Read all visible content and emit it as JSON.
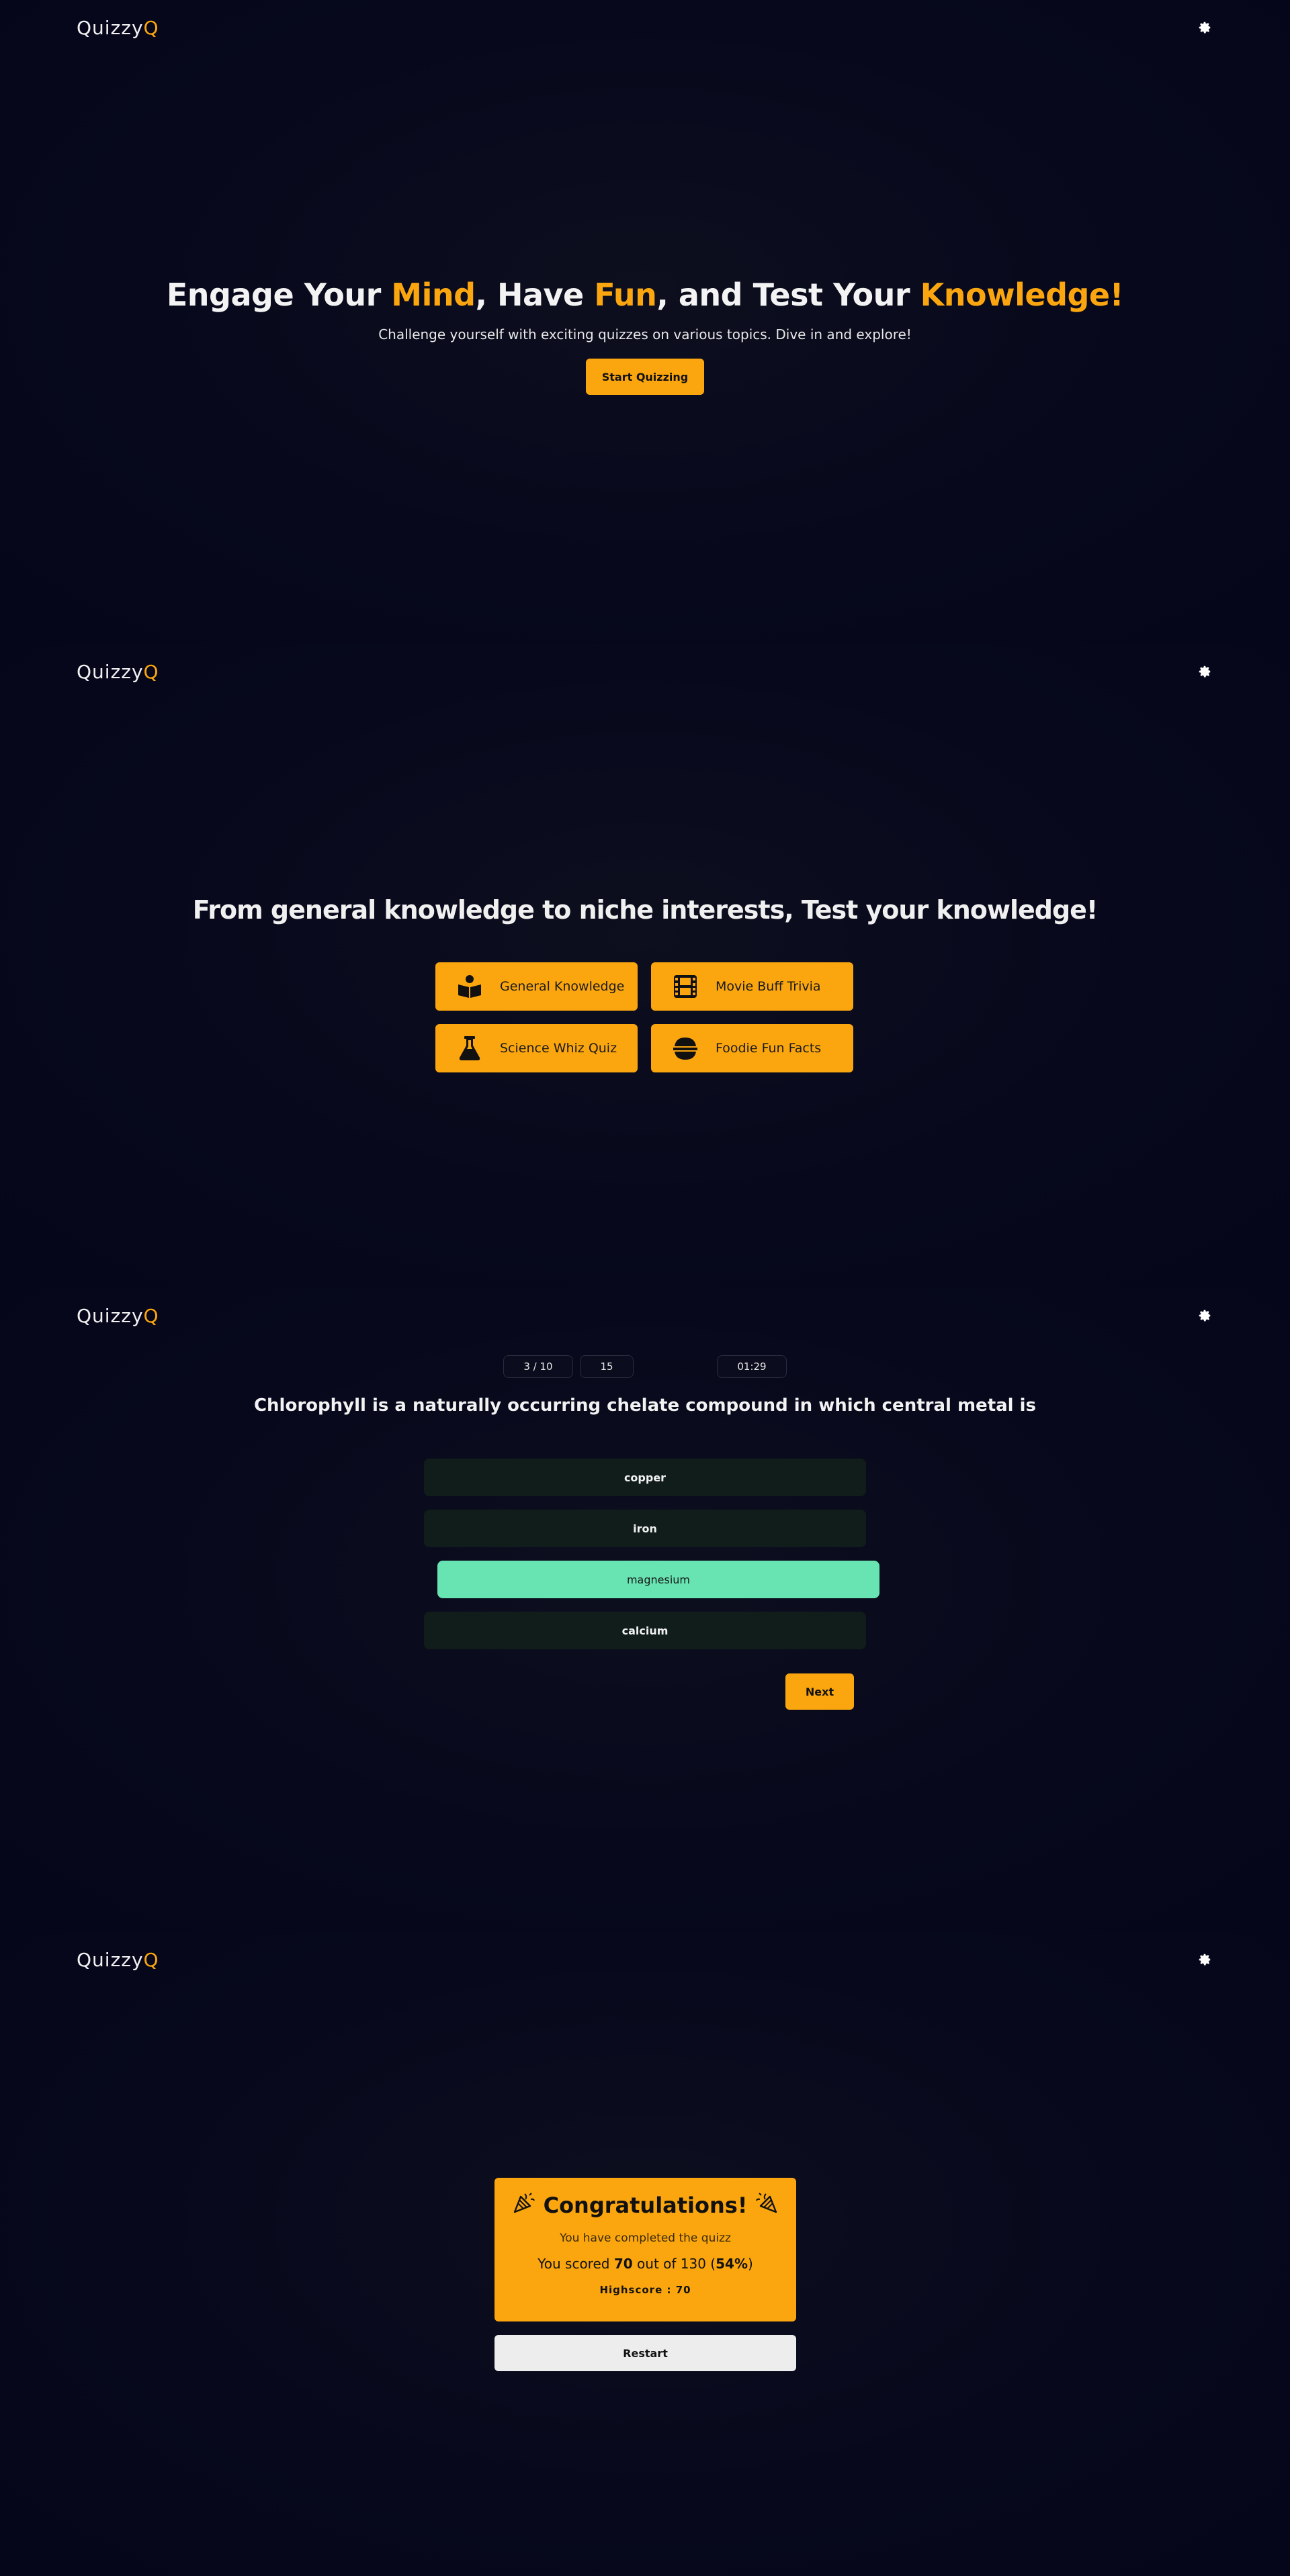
{
  "brand": {
    "name": "Quizzy",
    "accent_letter": "Q",
    "accent_color": "#fba60f"
  },
  "settings_icon": "gear-icon",
  "hero": {
    "title_parts": [
      "Engage Your ",
      "Mind",
      ", Have ",
      "Fun",
      ", and Test Your ",
      "Knowledge!"
    ],
    "subtitle": "Challenge yourself with exciting quizzes on various topics. Dive in and explore!",
    "start_label": "Start Quizzing"
  },
  "categories": {
    "title": "From general knowledge to niche interests, Test your knowledge!",
    "items": [
      {
        "label": "General Knowledge",
        "icon": "book-reader-icon"
      },
      {
        "label": "Movie Buff Trivia",
        "icon": "film-icon"
      },
      {
        "label": "Science Whiz Quiz",
        "icon": "flask-icon"
      },
      {
        "label": "Foodie Fun Facts",
        "icon": "food-bowl-icon"
      }
    ]
  },
  "quiz": {
    "progress": "3 / 10",
    "score": "15",
    "timer": "01:29",
    "question": "Chlorophyll is a naturally occurring chelate compound in which central metal is",
    "options": [
      "copper",
      "iron",
      "magnesium",
      "calcium"
    ],
    "selected_index": 2,
    "next_label": "Next"
  },
  "result": {
    "title": "Congratulations!",
    "completed": "You have completed the quizz",
    "scored_prefix": "You scored ",
    "score": "70",
    "scored_mid": " out of 130 (",
    "percent": "54%",
    "scored_suffix": ")",
    "highscore": "Highscore : 70",
    "restart_label": "Restart"
  }
}
